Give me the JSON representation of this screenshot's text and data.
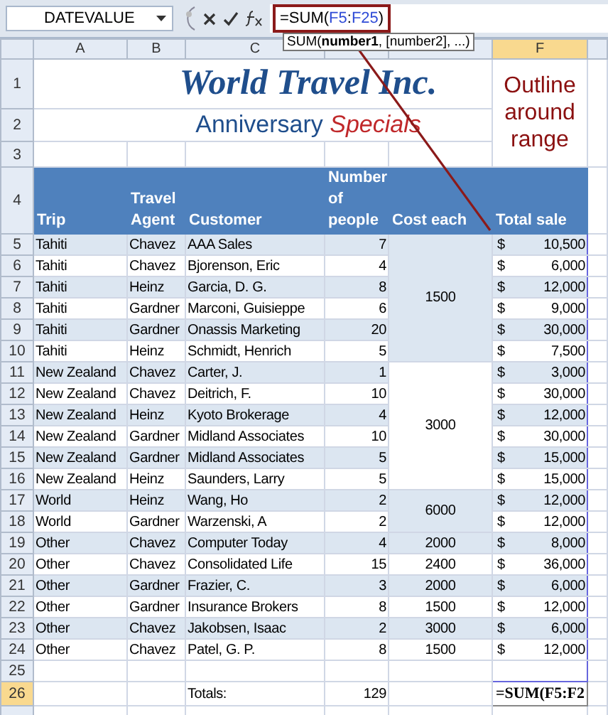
{
  "name_box": "DATEVALUE",
  "formula": [
    {
      "text": "=SUM(",
      "kind": "plain"
    },
    {
      "text": "F5",
      "kind": "ref"
    },
    {
      "text": ":",
      "kind": "plain"
    },
    {
      "text": "F25",
      "kind": "ref"
    },
    {
      "text": ")",
      "kind": "plain"
    }
  ],
  "tooltip": "SUM(**number1**, [number2], ...)",
  "columns": [
    {
      "label": "A",
      "selected": false
    },
    {
      "label": "B",
      "selected": false
    },
    {
      "label": "C",
      "selected": false
    },
    {
      "selected": false
    },
    {
      "selected": false
    },
    {
      "label": "F",
      "selected": true
    }
  ],
  "title": {
    "number": "1",
    "text": "World Travel Inc."
  },
  "subtitle": {
    "number": "2",
    "text": "Anniversary",
    "accent": "Specials"
  },
  "blank_top": {
    "number": "3"
  },
  "callout": "Outline around range",
  "header_row": {
    "number": "4",
    "cells": [
      "Trip",
      "Travel Agent",
      "Customer",
      "Number of people",
      "Cost each",
      "Total sale"
    ]
  },
  "groups": [
    {
      "cost": "1500",
      "rows": [
        {
          "number": "5",
          "trip": "Tahiti",
          "agent": "Chavez",
          "customer": "AAA Sales",
          "people": "7",
          "currency": "$",
          "total": "10,500"
        },
        {
          "number": "6",
          "trip": "Tahiti",
          "agent": "Chavez",
          "customer": "Bjorenson, Eric",
          "people": "4",
          "currency": "$",
          "total": "6,000"
        },
        {
          "number": "7",
          "trip": "Tahiti",
          "agent": "Heinz",
          "customer": "Garcia, D. G.",
          "people": "8",
          "currency": "$",
          "total": "12,000"
        },
        {
          "number": "8",
          "trip": "Tahiti",
          "agent": "Gardner",
          "customer": "Marconi, Guisieppe",
          "people": "6",
          "currency": "$",
          "total": "9,000"
        },
        {
          "number": "9",
          "trip": "Tahiti",
          "agent": "Gardner",
          "customer": "Onassis Marketing",
          "people": "20",
          "currency": "$",
          "total": "30,000"
        },
        {
          "number": "10",
          "trip": "Tahiti",
          "agent": "Heinz",
          "customer": "Schmidt, Henrich",
          "people": "5",
          "currency": "$",
          "total": "7,500"
        }
      ]
    },
    {
      "cost": "3000",
      "rows": [
        {
          "number": "11",
          "trip": "New Zealand",
          "agent": "Chavez",
          "customer": "Carter, J.",
          "people": "1",
          "currency": "$",
          "total": "3,000"
        },
        {
          "number": "12",
          "trip": "New Zealand",
          "agent": "Chavez",
          "customer": "Deitrich, F.",
          "people": "10",
          "currency": "$",
          "total": "30,000"
        },
        {
          "number": "13",
          "trip": "New Zealand",
          "agent": "Heinz",
          "customer": "Kyoto Brokerage",
          "people": "4",
          "currency": "$",
          "total": "12,000"
        },
        {
          "number": "14",
          "trip": "New Zealand",
          "agent": "Gardner",
          "customer": "Midland Associates",
          "people": "10",
          "currency": "$",
          "total": "30,000"
        },
        {
          "number": "15",
          "trip": "New Zealand",
          "agent": "Gardner",
          "customer": "Midland Associates",
          "people": "5",
          "currency": "$",
          "total": "15,000"
        },
        {
          "number": "16",
          "trip": "New Zealand",
          "agent": "Heinz",
          "customer": "Saunders, Larry",
          "people": "5",
          "currency": "$",
          "total": "15,000"
        }
      ]
    },
    {
      "cost": "6000",
      "rows": [
        {
          "number": "17",
          "trip": "World",
          "agent": "Heinz",
          "customer": "Wang, Ho",
          "people": "2",
          "currency": "$",
          "total": "12,000"
        },
        {
          "number": "18",
          "trip": "World",
          "agent": "Gardner",
          "customer": "Warzenski, A",
          "people": "2",
          "currency": "$",
          "total": "12,000"
        }
      ]
    },
    {
      "cost": "2000",
      "rows": [
        {
          "number": "19",
          "trip": "Other",
          "agent": "Chavez",
          "customer": "Computer Today",
          "people": "4",
          "currency": "$",
          "total": "8,000"
        }
      ]
    },
    {
      "cost": "2400",
      "rows": [
        {
          "number": "20",
          "trip": "Other",
          "agent": "Chavez",
          "customer": "Consolidated Life",
          "people": "15",
          "currency": "$",
          "total": "36,000"
        }
      ]
    },
    {
      "cost": "2000",
      "rows": [
        {
          "number": "21",
          "trip": "Other",
          "agent": "Gardner",
          "customer": "Frazier, C.",
          "people": "3",
          "currency": "$",
          "total": "6,000"
        }
      ]
    },
    {
      "cost": "1500",
      "rows": [
        {
          "number": "22",
          "trip": "Other",
          "agent": "Gardner",
          "customer": "Insurance Brokers",
          "people": "8",
          "currency": "$",
          "total": "12,000"
        }
      ]
    },
    {
      "cost": "3000",
      "rows": [
        {
          "number": "23",
          "trip": "Other",
          "agent": "Chavez",
          "customer": "Jakobsen, Isaac",
          "people": "2",
          "currency": "$",
          "total": "6,000"
        }
      ]
    },
    {
      "cost": "1500",
      "rows": [
        {
          "number": "24",
          "trip": "Other",
          "agent": "Chavez",
          "customer": "Patel, G. P.",
          "people": "8",
          "currency": "$",
          "total": "12,000"
        }
      ]
    }
  ],
  "blank_bottom": {
    "number": "25"
  },
  "totals_row": {
    "number": "26",
    "selected": true,
    "label": "Totals:",
    "people": "129",
    "edit": "=SUM(F5:F2"
  }
}
